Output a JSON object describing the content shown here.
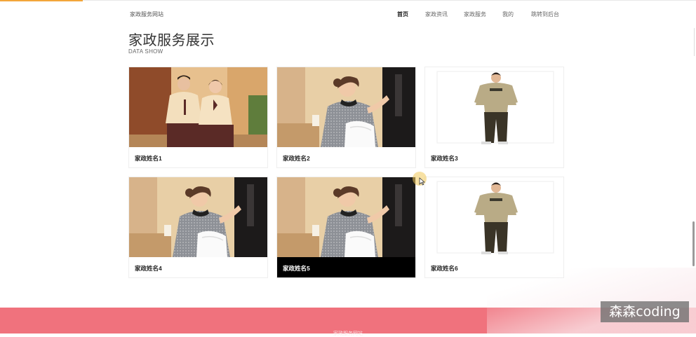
{
  "header": {
    "site_name": "家政服务网站",
    "nav": [
      "首页",
      "家政资讯",
      "家政服务",
      "我的",
      "跳转到后台"
    ],
    "active_index": 0
  },
  "section": {
    "title": "家政服务展示",
    "subtitle": "DATA SHOW"
  },
  "cards": [
    {
      "name": "家政姓名1",
      "image": "couple-in-beige-uniforms"
    },
    {
      "name": "家政姓名2",
      "image": "housekeeper-with-towel"
    },
    {
      "name": "家政姓名3",
      "image": "worker-khaki-uniform"
    },
    {
      "name": "家政姓名4",
      "image": "housekeeper-with-towel"
    },
    {
      "name": "家政姓名5",
      "image": "housekeeper-with-towel"
    },
    {
      "name": "家政姓名6",
      "image": "worker-khaki-uniform"
    }
  ],
  "footer": {
    "text": "家政服务网站"
  },
  "watermark": "森森coding",
  "colors": {
    "accent": "#f3a63a",
    "footer": "#f0727d",
    "caption_hover": "#000000"
  }
}
